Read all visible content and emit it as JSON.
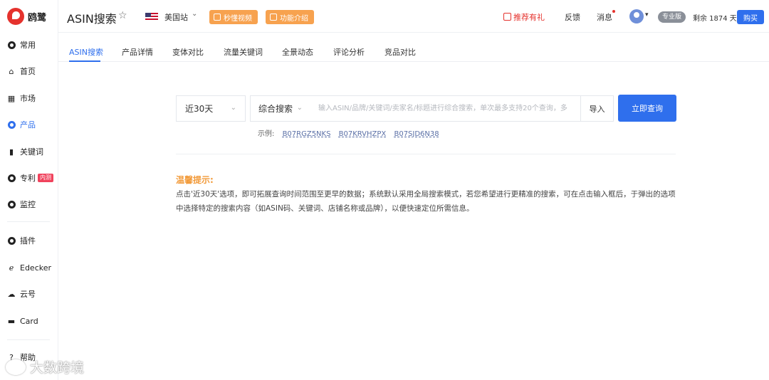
{
  "brand": {
    "name": "鸥鹭"
  },
  "sidebar": {
    "items": [
      {
        "label": "常用",
        "icon": "circle-icon"
      },
      {
        "label": "首页",
        "icon": "home-icon"
      },
      {
        "label": "市场",
        "icon": "grid-icon"
      },
      {
        "label": "产品",
        "icon": "eye-icon",
        "active": true
      },
      {
        "label": "关键词",
        "icon": "bar-chart-icon"
      },
      {
        "label": "专利",
        "icon": "shield-icon",
        "badge": "内测"
      },
      {
        "label": "监控",
        "icon": "monitor-icon"
      },
      {
        "label": "插件",
        "icon": "chrome-icon"
      },
      {
        "label": "Edecker",
        "icon": "edecker-icon"
      },
      {
        "label": "云号",
        "icon": "cloud-icon"
      },
      {
        "label": "Card",
        "icon": "card-icon"
      },
      {
        "label": "帮助",
        "icon": "help-icon"
      }
    ]
  },
  "header": {
    "title": "ASIN搜索",
    "station": "美国站",
    "video_btn": "秒懂视频",
    "intro_btn": "功能介绍",
    "recommend": "推荐有礼",
    "feedback": "反馈",
    "messages": "消息",
    "plan": "专业版",
    "remain": "剩余 1874 天",
    "buy": "购买"
  },
  "tabs": [
    "ASIN搜索",
    "产品详情",
    "变体对比",
    "流量关键词",
    "全景动态",
    "评论分析",
    "竞品对比"
  ],
  "search": {
    "period": "近30天",
    "mode": "综合搜索",
    "placeholder": "输入ASIN/品牌/关键词/卖家名/标题进行综合搜索，单次最多支持20个查询，多",
    "import": "导入",
    "submit": "立即查询",
    "examples_label": "示例:",
    "examples": [
      "B07RGZ5NKS",
      "B07KRVHZPX",
      "B07SJD6N38"
    ]
  },
  "tip": {
    "title": "温馨提示:",
    "body": "点击'近30天'选项，即可拓展查询时间范围至更早的数据；系统默认采用全局搜索模式，若您希望进行更精准的搜索，可在点击输入框后，于弹出的选项中选择特定的搜索内容（如ASIN码、关键词、店铺名称或品牌），以便快速定位所需信息。"
  },
  "watermark": "大数跨境",
  "colors": {
    "accent": "#2f6fed",
    "brand": "#e5322d",
    "orange": "#f7a24f",
    "tip": "#f29b3b"
  }
}
